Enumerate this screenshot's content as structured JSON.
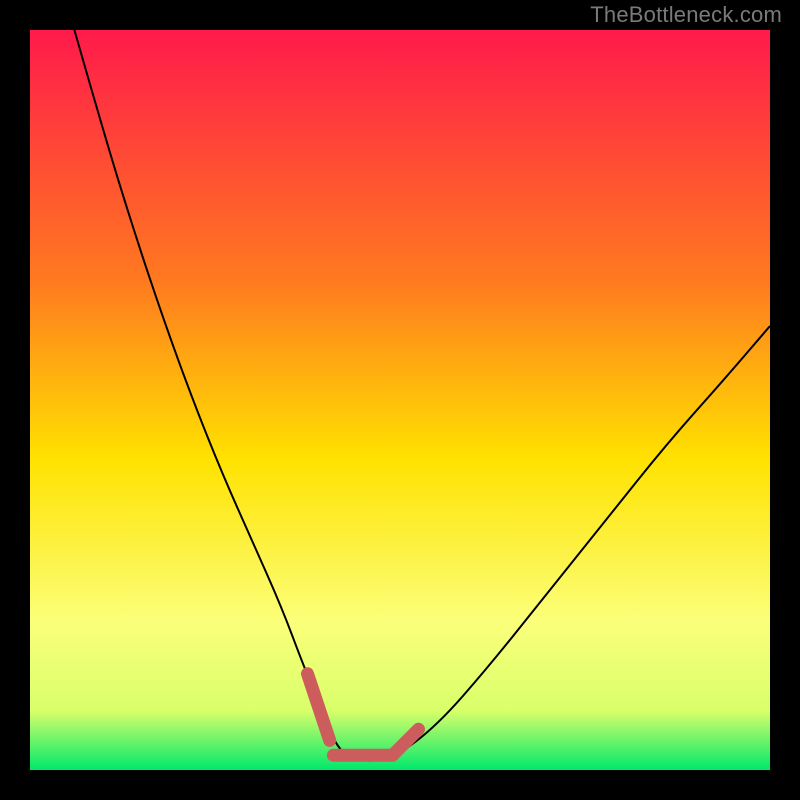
{
  "watermark": "TheBottleneck.com",
  "colors": {
    "frame": "#000000",
    "gradient_top": "#ff1a4b",
    "gradient_mid1": "#ff7a1f",
    "gradient_mid2": "#ffe200",
    "gradient_low": "#fbff7a",
    "gradient_band": "#d8ff6a",
    "gradient_bottom": "#00e86b",
    "curve": "#000000",
    "marker": "#cd5c5c"
  },
  "chart_data": {
    "type": "line",
    "title": "",
    "xlabel": "",
    "ylabel": "",
    "xlim": [
      0,
      100
    ],
    "ylim": [
      0,
      100
    ],
    "series": [
      {
        "name": "bottleneck-curve",
        "x": [
          6,
          10,
          14,
          18,
          22,
          26,
          30,
          34,
          37,
          39.5,
          41,
          43,
          46,
          49,
          55,
          62,
          70,
          78,
          86,
          94,
          100
        ],
        "y": [
          100,
          86,
          73,
          61,
          50,
          40,
          31,
          22,
          14,
          8,
          4,
          1.5,
          1.2,
          1.5,
          6,
          14,
          24,
          34,
          44,
          53,
          60
        ]
      }
    ],
    "markers": [
      {
        "name": "left-knee",
        "x": [
          37.5,
          40.5
        ],
        "y": [
          13,
          4
        ]
      },
      {
        "name": "trough",
        "x": [
          41,
          49
        ],
        "y": [
          2,
          2
        ]
      },
      {
        "name": "right-knee",
        "x": [
          49,
          52.5
        ],
        "y": [
          2,
          5.5
        ]
      }
    ],
    "background_gradient_stops": [
      {
        "pct": 0,
        "color": "#ff1a4b"
      },
      {
        "pct": 34,
        "color": "#ff7a1f"
      },
      {
        "pct": 58,
        "color": "#ffe200"
      },
      {
        "pct": 80,
        "color": "#fbff7a"
      },
      {
        "pct": 92,
        "color": "#d8ff6a"
      },
      {
        "pct": 100,
        "color": "#00e86b"
      }
    ]
  }
}
